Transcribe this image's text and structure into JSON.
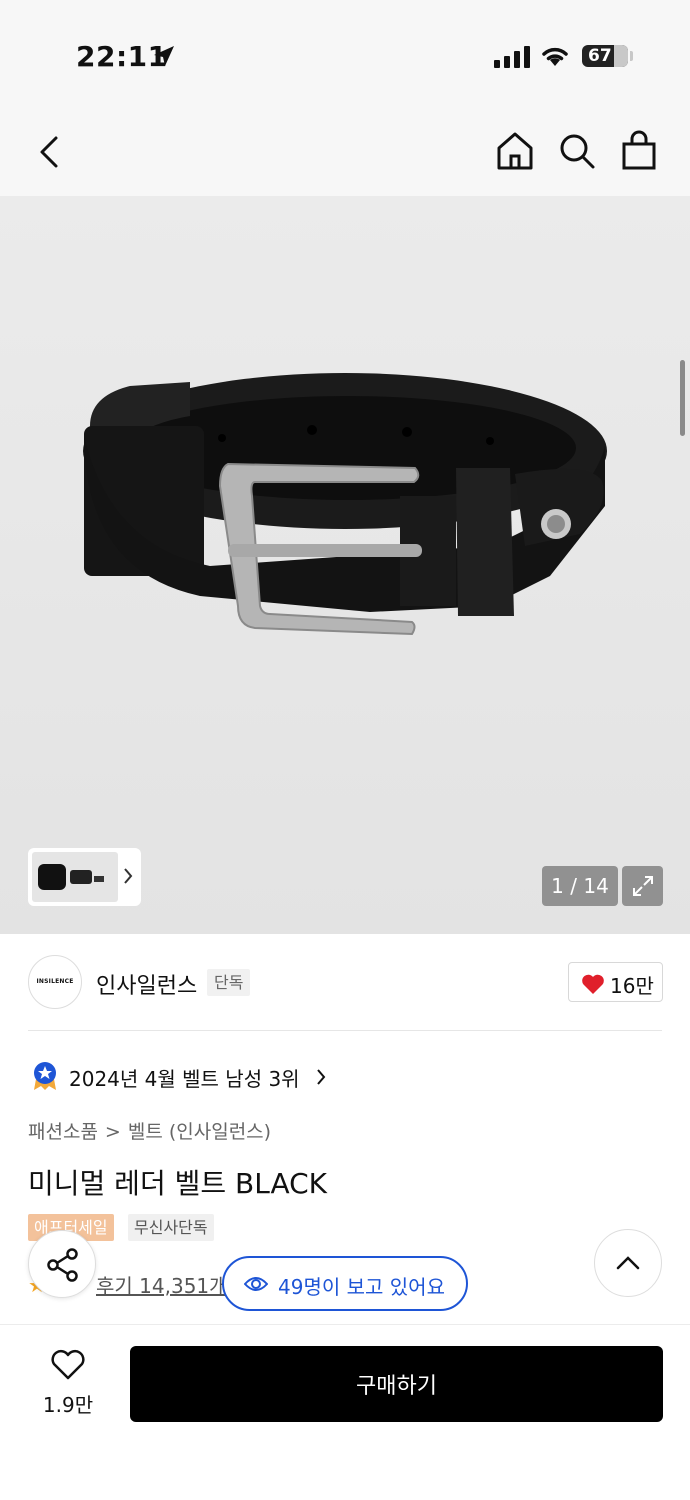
{
  "status_bar": {
    "time": "22:11",
    "battery": "67"
  },
  "gallery": {
    "counter": "1 / 14"
  },
  "brand": {
    "logo_text": "INSILENCE",
    "name": "인사일런스",
    "tag": "단독",
    "like_count": "16만"
  },
  "ranking": {
    "text": "2024년 4월 벨트 남성 3위"
  },
  "breadcrumb": {
    "category": "패션소품",
    "sub": "벨트 (인사일런스)",
    "separator": ">"
  },
  "product": {
    "title": "미니멀 레더 벨트 BLACK",
    "badges": [
      "애프터세일",
      "무신사단독"
    ],
    "review_label": "후기 14,351개"
  },
  "viewers": {
    "text": "49명이 보고 있어요"
  },
  "bottom_bar": {
    "wish_count": "1.9만",
    "buy_label": "구매하기"
  },
  "colors": {
    "accent_blue": "#1e55d6",
    "heart_red": "#e01f2b",
    "badge_orange": "#f3c29b"
  }
}
